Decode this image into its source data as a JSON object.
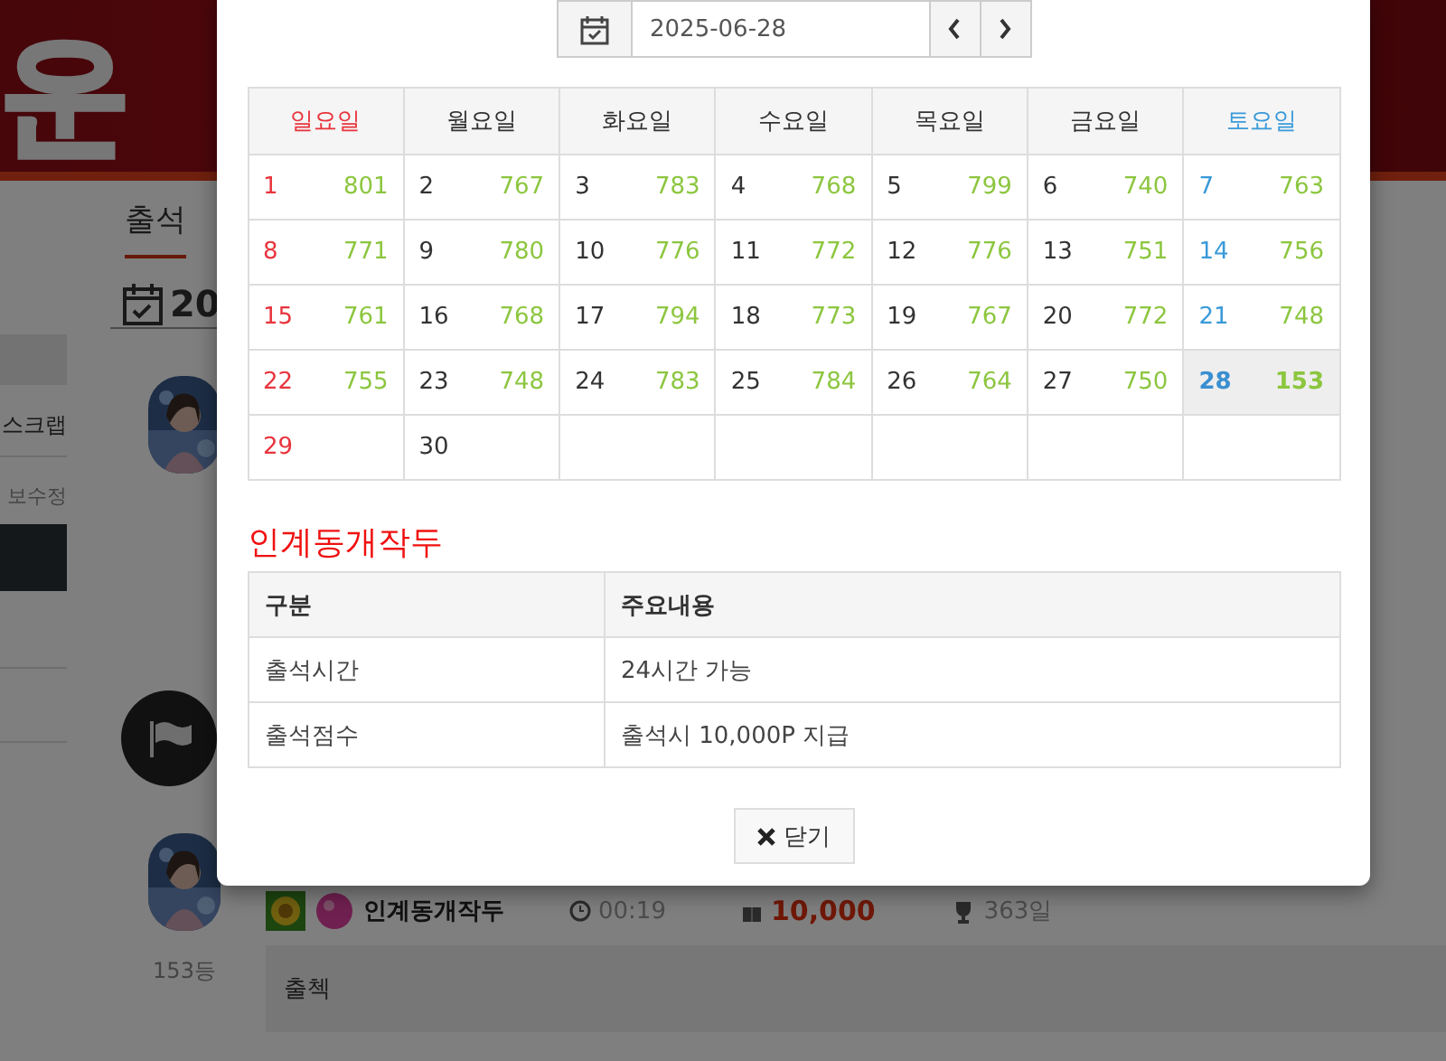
{
  "banner": {
    "title": "운"
  },
  "sidebar": {
    "items": [
      {
        "label": "스크랩"
      },
      {
        "label": "보수정"
      }
    ]
  },
  "page": {
    "tab": "출석",
    "heading": "20"
  },
  "posts": [
    {
      "kind": "avatar"
    },
    {
      "kind": "flag"
    },
    {
      "kind": "avatar",
      "rank": "153등"
    }
  ],
  "entry": {
    "name": "인계동개작두",
    "time": "00:19",
    "points": "10,000",
    "days": "363일",
    "comment": "출첵"
  },
  "modal": {
    "date": "2025-06-28",
    "weekdays": [
      "일요일",
      "월요일",
      "화요일",
      "수요일",
      "목요일",
      "금요일",
      "토요일"
    ],
    "weeks": [
      [
        {
          "day": "1",
          "count": "801",
          "selected": false
        },
        {
          "day": "2",
          "count": "767",
          "selected": false
        },
        {
          "day": "3",
          "count": "783",
          "selected": false
        },
        {
          "day": "4",
          "count": "768",
          "selected": false
        },
        {
          "day": "5",
          "count": "799",
          "selected": false
        },
        {
          "day": "6",
          "count": "740",
          "selected": false
        },
        {
          "day": "7",
          "count": "763",
          "selected": false
        }
      ],
      [
        {
          "day": "8",
          "count": "771",
          "selected": false
        },
        {
          "day": "9",
          "count": "780",
          "selected": false
        },
        {
          "day": "10",
          "count": "776",
          "selected": false
        },
        {
          "day": "11",
          "count": "772",
          "selected": false
        },
        {
          "day": "12",
          "count": "776",
          "selected": false
        },
        {
          "day": "13",
          "count": "751",
          "selected": false
        },
        {
          "day": "14",
          "count": "756",
          "selected": false
        }
      ],
      [
        {
          "day": "15",
          "count": "761",
          "selected": false
        },
        {
          "day": "16",
          "count": "768",
          "selected": false
        },
        {
          "day": "17",
          "count": "794",
          "selected": false
        },
        {
          "day": "18",
          "count": "773",
          "selected": false
        },
        {
          "day": "19",
          "count": "767",
          "selected": false
        },
        {
          "day": "20",
          "count": "772",
          "selected": false
        },
        {
          "day": "21",
          "count": "748",
          "selected": false
        }
      ],
      [
        {
          "day": "22",
          "count": "755",
          "selected": false
        },
        {
          "day": "23",
          "count": "748",
          "selected": false
        },
        {
          "day": "24",
          "count": "783",
          "selected": false
        },
        {
          "day": "25",
          "count": "784",
          "selected": false
        },
        {
          "day": "26",
          "count": "764",
          "selected": false
        },
        {
          "day": "27",
          "count": "750",
          "selected": false
        },
        {
          "day": "28",
          "count": "153",
          "selected": true
        }
      ],
      [
        {
          "day": "29",
          "selected": false
        },
        {
          "day": "30",
          "selected": false
        }
      ]
    ],
    "section_title": "인계동개작두",
    "info": {
      "columns": [
        "구분",
        "주요내용"
      ],
      "rows": [
        [
          "출석시간",
          "24시간 가능"
        ],
        [
          "출석점수",
          "출석시 10,000P 지급"
        ]
      ]
    },
    "close_label": "닫기"
  }
}
